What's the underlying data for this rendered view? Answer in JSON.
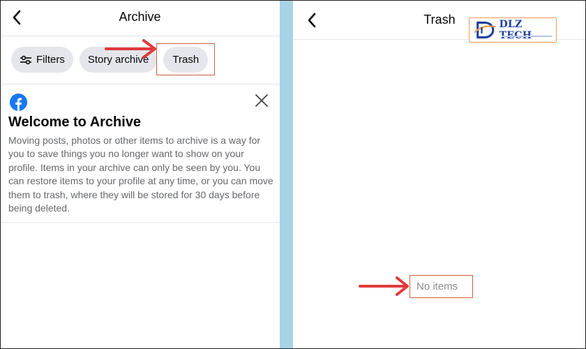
{
  "archive": {
    "title": "Archive",
    "chips": {
      "filters": "Filters",
      "story_archive": "Story archive",
      "trash": "Trash"
    },
    "welcome": {
      "title": "Welcome to Archive",
      "body": "Moving posts, photos or other items to archive is a way for you to save things you no longer want to show on your profile. Items in your archive can only be seen by you. You can restore items to your profile at any time, or you can move them to trash, where they will be stored for 30 days before being deleted."
    }
  },
  "trash": {
    "title": "Trash",
    "empty_text": "No items"
  },
  "watermark": {
    "text": "DLZ TECH"
  },
  "colors": {
    "facebook_blue": "#1877f2",
    "arrow_red": "#e03a3a",
    "highlight_border": "#c8603f",
    "chip_bg": "#e4e6eb",
    "divider_strip": "#a8d3e4"
  },
  "icons": {
    "back": "chevron-left-icon",
    "filters": "sliders-icon",
    "close": "close-icon",
    "facebook": "facebook-logo-icon"
  }
}
